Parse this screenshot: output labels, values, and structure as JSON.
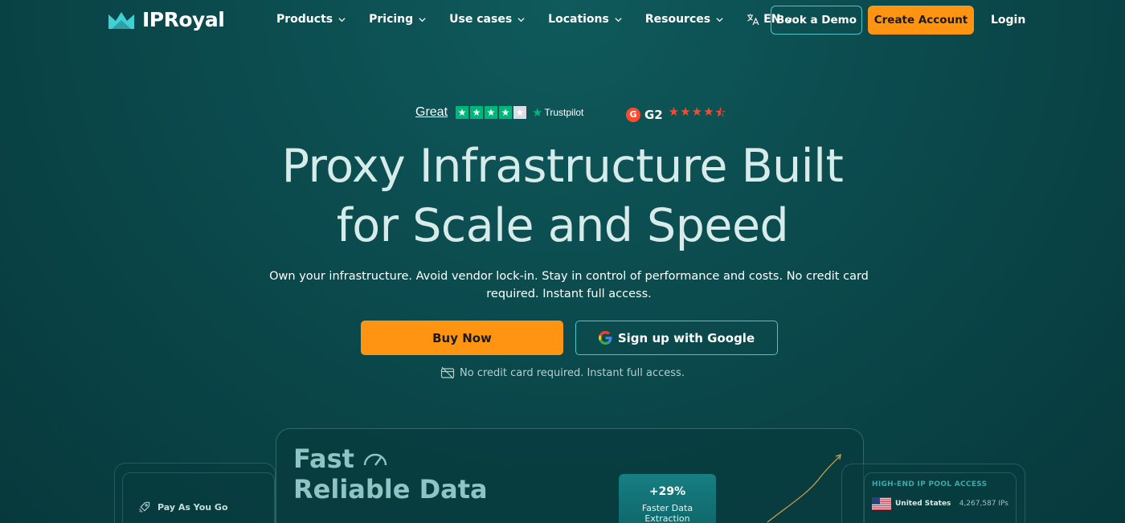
{
  "brand": {
    "name": "IPRoyal"
  },
  "nav": {
    "items": [
      {
        "label": "Products"
      },
      {
        "label": "Pricing"
      },
      {
        "label": "Use cases"
      },
      {
        "label": "Locations"
      },
      {
        "label": "Resources"
      }
    ],
    "language": "EN",
    "book_demo": "Book a Demo",
    "create_account": "Create Account",
    "login": "Login"
  },
  "ratings": {
    "trustpilot_word": "Great",
    "trustpilot_stars": 4,
    "trustpilot_brand": "Trustpilot",
    "g2_badge": "G",
    "g2_label": "G2",
    "g2_stars": 4.5
  },
  "hero": {
    "title_line1": "Proxy Infrastructure Built",
    "title_line2": "for Scale and Speed",
    "subtitle": "Own your infrastructure. Avoid vendor lock-in. Stay in control of performance and costs. No credit card required. Instant full access.",
    "buy_now": "Buy Now",
    "google_signup": "Sign up with Google",
    "note": "No credit card required. Instant full access."
  },
  "preview": {
    "fast": "Fast",
    "reliable": "Reliable Data",
    "pay_label": "Pay As You Go",
    "stat_value": "+29%",
    "stat_label_line1": "Faster Data",
    "stat_label_line2": "Extraction",
    "pool_title": "HIGH-END IP POOL ACCESS",
    "pool_country": "United States",
    "pool_ips": "4,267,587 IPs"
  },
  "colors": {
    "background": "#0b4a4d",
    "accent_orange": "#ff9412",
    "accent_teal": "#4cc6c6",
    "trustpilot_green": "#00b67a",
    "g2_red": "#ff492c"
  }
}
